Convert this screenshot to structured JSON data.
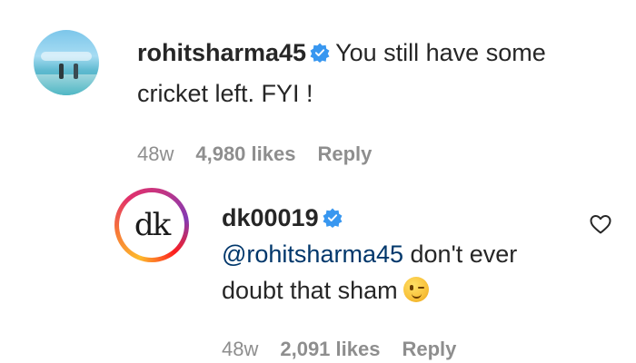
{
  "comment1": {
    "username": "rohitsharma45",
    "text": "You still have some cricket left. FYI !",
    "time": "48w",
    "likes": "4,980 likes",
    "reply": "Reply"
  },
  "comment2": {
    "username": "dk00019",
    "mention": "@rohitsharma45",
    "text": "don't ever doubt that sham",
    "avatar_text": "dk",
    "time": "48w",
    "likes": "2,091 likes",
    "reply": "Reply"
  },
  "colors": {
    "verified": "#3897f0",
    "mention": "#00376b",
    "meta": "#8e8e8e"
  },
  "icons": [
    "verified-badge-icon",
    "heart-icon",
    "wink-emoji-icon"
  ]
}
